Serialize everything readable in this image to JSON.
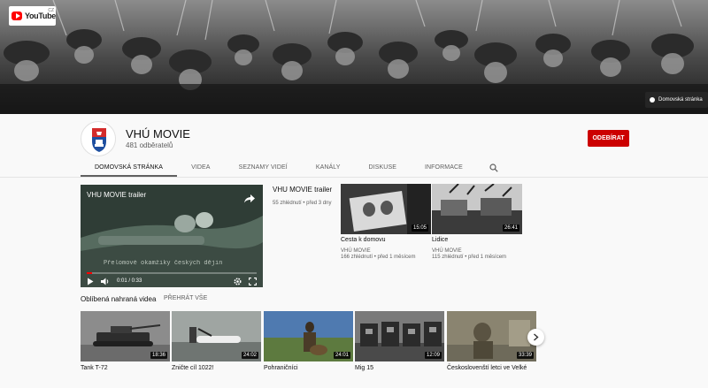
{
  "brand": {
    "logo_text": "YouTube",
    "logo_region": "CZ"
  },
  "banner": {
    "home_chip": "Domovská stránka"
  },
  "channel": {
    "name": "VHÚ MOVIE",
    "subscribers": "481 odběratelů",
    "subscribe_label": "ODEBÍRAT"
  },
  "tabs": [
    {
      "label": "DOMOVSKÁ STRÁNKA",
      "active": true
    },
    {
      "label": "VIDEA"
    },
    {
      "label": "SEZNAMY VIDEÍ"
    },
    {
      "label": "KANÁLY"
    },
    {
      "label": "DISKUSE"
    },
    {
      "label": "INFORMACE"
    }
  ],
  "featured": {
    "player_title": "VHU MOVIE trailer",
    "subtitle": "Přelomové okamžiky českých dějin",
    "time": "0:01 / 0:33",
    "progress": 0.03,
    "title": "VHU MOVIE trailer",
    "meta": "55 zhlédnutí • před 3 dny"
  },
  "side_videos": [
    {
      "title": "Cesta k domovu",
      "channel": "VHÚ MOVIE",
      "meta": "166 zhlédnutí • před 1 měsícem",
      "duration": "15:05"
    },
    {
      "title": "Lidice",
      "channel": "VHÚ MOVIE",
      "meta": "115 zhlédnutí • před 1 měsícem",
      "duration": "26:41"
    }
  ],
  "shelf": {
    "title": "Oblíbená nahraná videa",
    "play_all": "PŘEHRÁT VŠE",
    "items": [
      {
        "title": "Tank T-72",
        "duration": "18:36"
      },
      {
        "title": "Zničte cíl 1022!",
        "duration": "24:02"
      },
      {
        "title": "Pohraničníci",
        "duration": "24:01"
      },
      {
        "title": "Mig 15",
        "duration": "12:09"
      },
      {
        "title": "Českoslovenští letci ve Velké",
        "duration": "33:39"
      }
    ]
  },
  "colors": {
    "accent": "#cc0000",
    "progress": "#ff0000"
  },
  "icons": {
    "search": "search-icon",
    "next": "chevron-right-icon",
    "share": "share-icon"
  }
}
